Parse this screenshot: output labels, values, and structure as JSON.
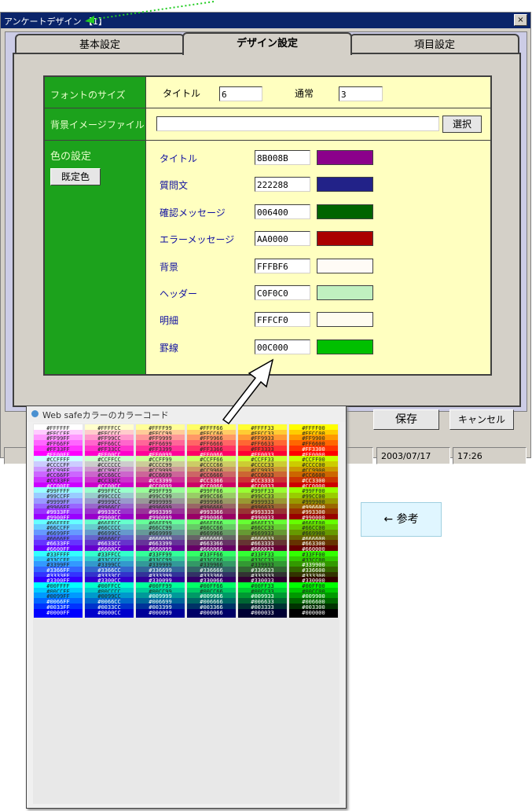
{
  "window": {
    "title": "アンケートデザイン 【1】",
    "close_glyph": "×"
  },
  "tabs": [
    {
      "label": "基本設定"
    },
    {
      "label": "デザイン設定",
      "active": true
    },
    {
      "label": "項目設定"
    }
  ],
  "font_size": {
    "section_label": "フォントのサイズ",
    "title_label": "タイトル",
    "title_value": "6",
    "normal_label": "通常",
    "normal_value": "3"
  },
  "background_image": {
    "section_label": "背景イメージファイル",
    "value": "",
    "select_button": "選択"
  },
  "colors": {
    "section_label": "色の設定",
    "default_button": "既定色",
    "items": [
      {
        "label": "タイトル",
        "code": "8B008B",
        "swatch": "#8B008B"
      },
      {
        "label": "質問文",
        "code": "222288",
        "swatch": "#222288"
      },
      {
        "label": "確認メッセージ",
        "code": "006400",
        "swatch": "#006400"
      },
      {
        "label": "エラーメッセージ",
        "code": "AA0000",
        "swatch": "#AA0000"
      },
      {
        "label": "背景",
        "code": "FFFBF6",
        "swatch": "#FFFBF6"
      },
      {
        "label": "ヘッダー",
        "code": "C0F0C0",
        "swatch": "#C0F0C0"
      },
      {
        "label": "明細",
        "code": "FFFCF0",
        "swatch": "#FFFCF0"
      },
      {
        "label": "罫線",
        "code": "00C000",
        "swatch": "#00C000"
      }
    ]
  },
  "buttons": {
    "save": "保存",
    "cancel": "キャンセル"
  },
  "status_bar": {
    "date": "2003/07/17",
    "time": "17:26"
  },
  "color_chart": {
    "title": "Web safeカラーのカラーコード",
    "columns": [
      "FF",
      "CC",
      "99",
      "66",
      "33",
      "00"
    ],
    "row_prefixes": [
      "FF",
      "CC",
      "99",
      "66",
      "33",
      "00"
    ]
  },
  "reference_note": "← 参考"
}
